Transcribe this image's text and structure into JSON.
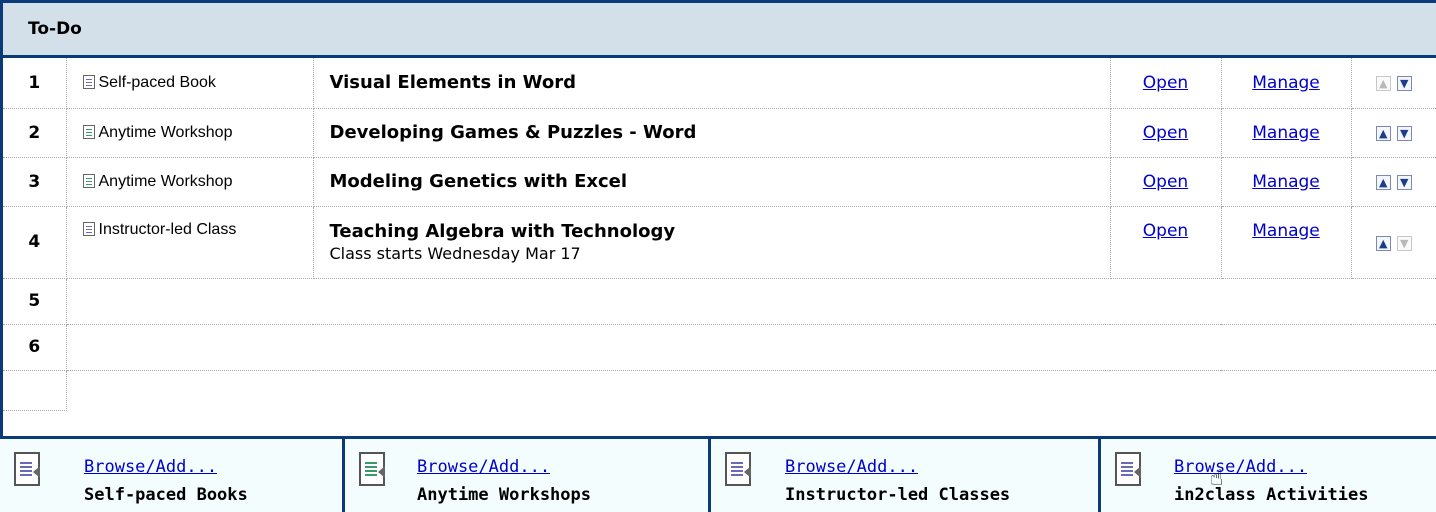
{
  "header": {
    "title": "To-Do"
  },
  "rows": [
    {
      "num": "1",
      "type": "Self-paced Book",
      "icon": "book-doc-icon",
      "title": "Visual Elements in Word",
      "subtitle": "",
      "open": "Open",
      "manage": "Manage",
      "up_enabled": false,
      "down_enabled": true
    },
    {
      "num": "2",
      "type": "Anytime Workshop",
      "icon": "workshop-doc-icon",
      "title": "Developing Games & Puzzles - Word",
      "subtitle": "",
      "open": "Open",
      "manage": "Manage",
      "up_enabled": true,
      "down_enabled": true
    },
    {
      "num": "3",
      "type": "Anytime Workshop",
      "icon": "workshop-doc-icon",
      "title": "Modeling Genetics with Excel",
      "subtitle": "",
      "open": "Open",
      "manage": "Manage",
      "up_enabled": true,
      "down_enabled": true
    },
    {
      "num": "4",
      "type": "Instructor-led Class",
      "icon": "class-doc-icon",
      "title": "Teaching Algebra with Technology",
      "subtitle": "Class starts Wednesday Mar 17",
      "open": "Open",
      "manage": "Manage",
      "up_enabled": true,
      "down_enabled": false
    },
    {
      "num": "5"
    },
    {
      "num": "6"
    }
  ],
  "footer": [
    {
      "browse": "Browse/Add...",
      "label": "Self-paced Books",
      "icon": "book-doc-icon"
    },
    {
      "browse": "Browse/Add...",
      "label": "Anytime Workshops",
      "icon": "workshop-doc-icon"
    },
    {
      "browse": "Browse/Add...",
      "label": "Instructor-led Classes",
      "icon": "class-doc-icon"
    },
    {
      "browse": "Browse/Add...",
      "label": "in2class Activities",
      "icon": "activity-doc-icon"
    }
  ],
  "colors": {
    "border": "#0a3a78",
    "header_bg": "#d3dfe9",
    "footer_bg": "#f3fdfd",
    "link": "#0000cc"
  }
}
